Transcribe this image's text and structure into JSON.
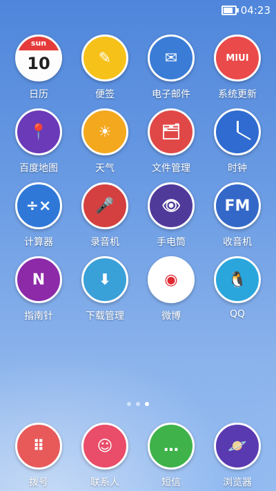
{
  "status": {
    "time": "04:23",
    "battery_level": 0.8
  },
  "apps": [
    {
      "label": "日历",
      "icon": "calendar-icon",
      "color": "#e8e8e8",
      "glyph": "",
      "cal_day": "sun",
      "cal_date": "10"
    },
    {
      "label": "便签",
      "icon": "notes-icon",
      "color": "#f6c21a",
      "glyph": "✎"
    },
    {
      "label": "电子邮件",
      "icon": "email-icon",
      "color": "#3a7cd6",
      "glyph": "✉"
    },
    {
      "label": "系统更新",
      "icon": "system-update-icon",
      "color": "#ea4a4a",
      "glyph": "MIUI"
    },
    {
      "label": "百度地图",
      "icon": "map-icon",
      "color": "#6a3ab8",
      "glyph": "📍"
    },
    {
      "label": "天气",
      "icon": "weather-icon",
      "color": "#f4a81e",
      "glyph": "☀"
    },
    {
      "label": "文件管理",
      "icon": "file-manager-icon",
      "color": "#e04848",
      "glyph": "🗂"
    },
    {
      "label": "时钟",
      "icon": "clock-icon",
      "color": "#2f6bd0",
      "glyph": ""
    },
    {
      "label": "计算器",
      "icon": "calculator-icon",
      "color": "#2f78d8",
      "glyph": "÷×"
    },
    {
      "label": "录音机",
      "icon": "recorder-icon",
      "color": "#d44040",
      "glyph": "🎤"
    },
    {
      "label": "手电筒",
      "icon": "flashlight-icon",
      "color": "#4f3a9a",
      "glyph": "👁"
    },
    {
      "label": "收音机",
      "icon": "radio-icon",
      "color": "#3468c8",
      "glyph": "FM"
    },
    {
      "label": "指南针",
      "icon": "compass-icon",
      "color": "#8d2aa8",
      "glyph": "N"
    },
    {
      "label": "下载管理",
      "icon": "download-icon",
      "color": "#3aa0d8",
      "glyph": "⬇"
    },
    {
      "label": "微博",
      "icon": "weibo-icon",
      "color": "#ffffff",
      "glyph": "◉"
    },
    {
      "label": "QQ",
      "icon": "qq-icon",
      "color": "#2aa6dc",
      "glyph": "🐧"
    }
  ],
  "page_indicator": {
    "pages": 3,
    "current": 3
  },
  "dock": [
    {
      "label": "拨号",
      "icon": "phone-icon",
      "color": "#e85a5a",
      "glyph": "⠿"
    },
    {
      "label": "联系人",
      "icon": "contacts-icon",
      "color": "#e94d6a",
      "glyph": "☺"
    },
    {
      "label": "短信",
      "icon": "messages-icon",
      "color": "#3fb24a",
      "glyph": "…"
    },
    {
      "label": "浏览器",
      "icon": "browser-icon",
      "color": "#5a3ab0",
      "glyph": "🪐"
    }
  ]
}
